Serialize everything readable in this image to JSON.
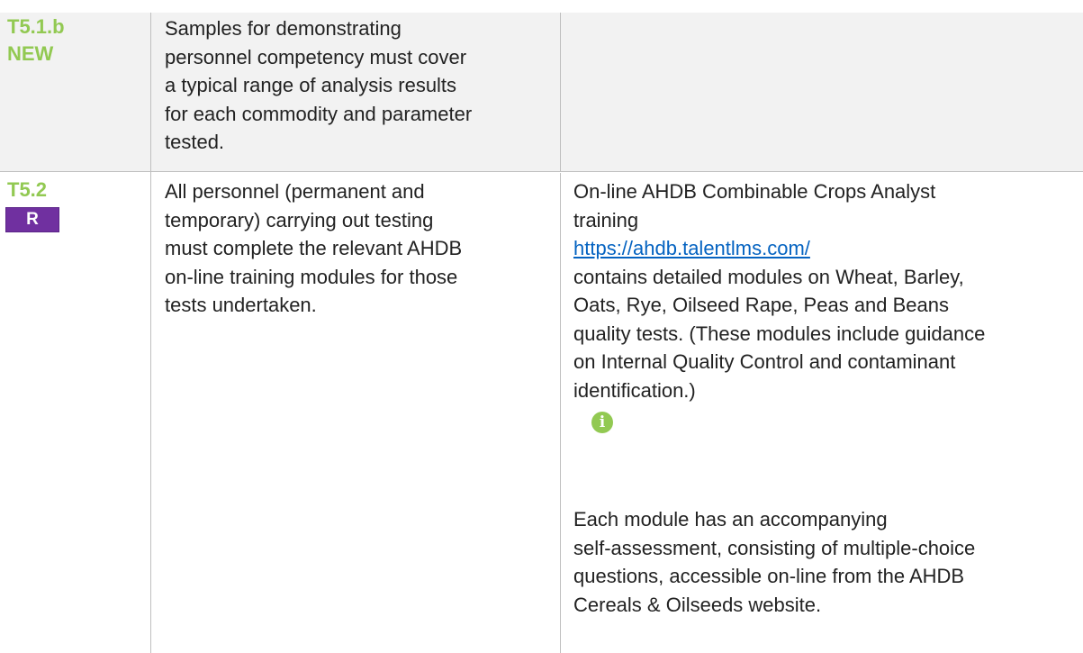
{
  "rows": [
    {
      "code": "T5.1.b",
      "tag": "NEW",
      "requirement": [
        "Samples for demonstrating",
        "personnel competency must cover",
        "a typical range of analysis results",
        "for each commodity and parameter",
        "tested."
      ],
      "guidance": []
    },
    {
      "code": "T5.2",
      "badge": "R",
      "requirement": [
        "All personnel (permanent and",
        "temporary) carrying out testing",
        "must complete the relevant AHDB",
        "on-line training modules for those",
        "tests undertaken."
      ],
      "guidance_intro": [
        "On-line AHDB Combinable Crops Analyst",
        "training"
      ],
      "guidance_link": "https://ahdb.talentlms.com/",
      "guidance_body": [
        "contains detailed modules on Wheat, Barley,",
        "Oats, Rye, Oilseed Rape, Peas and Beans",
        "quality tests. (These modules include guidance",
        "on Internal Quality Control and contaminant",
        "identification.)"
      ],
      "info_icon": "info-icon",
      "guidance_tail": [
        "Each module has an accompanying",
        "self-assessment, consisting of multiple-choice",
        "questions, accessible on-line from the AHDB",
        "Cereals & Oilseeds website."
      ]
    }
  ],
  "colors": {
    "code": "#92c952",
    "badge": "#7030a0",
    "link": "#0563c1",
    "shade": "#f2f2f2"
  }
}
